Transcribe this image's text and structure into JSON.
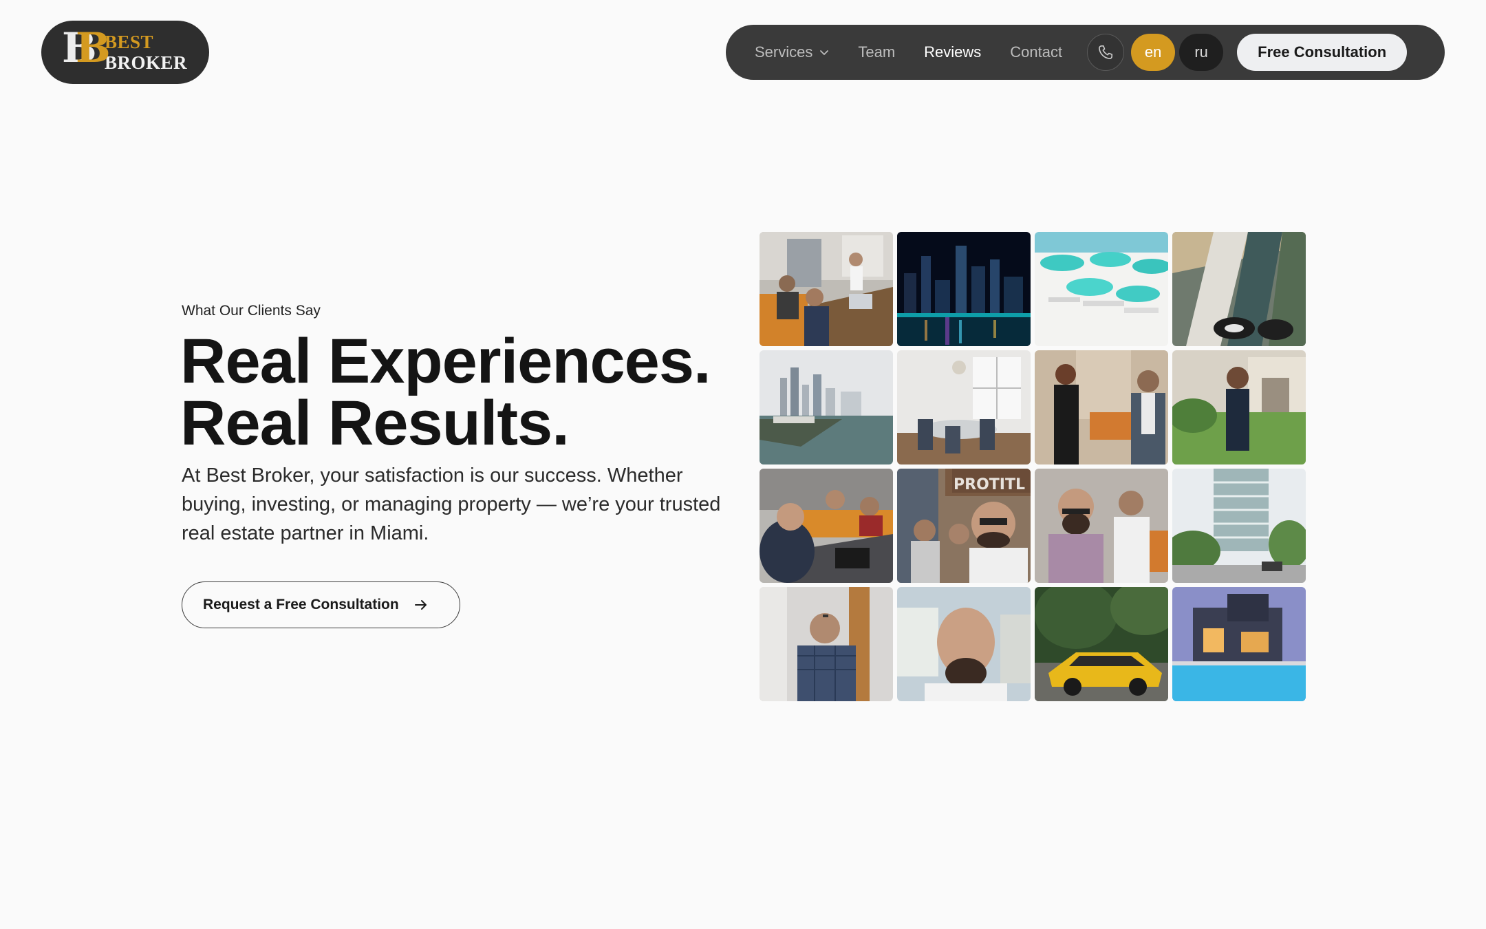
{
  "logo": {
    "monogram": "B",
    "word1": "BEST",
    "word2": "BROKER"
  },
  "nav": {
    "items": [
      {
        "label": "Services",
        "has_dropdown": true,
        "active": false
      },
      {
        "label": "Team",
        "active": false
      },
      {
        "label": "Reviews",
        "active": true
      },
      {
        "label": "Contact",
        "active": false
      }
    ],
    "phone_icon": "phone-icon",
    "languages": [
      {
        "code": "en",
        "selected": true
      },
      {
        "code": "ru",
        "selected": false
      }
    ],
    "cta_label": "Free Consultation"
  },
  "hero": {
    "eyebrow": "What Our Clients Say",
    "headline_line1": "Real Experiences.",
    "headline_line2": "Real Results.",
    "lead": "At Best Broker, your satisfaction is our success. Whether buying, investing, or managing property — we’re your trusted real estate partner in Miami.",
    "cta_label": "Request a Free Consultation",
    "cta_icon": "arrow-right-icon"
  },
  "gallery": {
    "tiles": [
      {
        "subject": "team-meeting-photo"
      },
      {
        "subject": "city-night-skyline-photo"
      },
      {
        "subject": "beach-umbrellas-photo"
      },
      {
        "subject": "aerial-coast-photo"
      },
      {
        "subject": "bay-skyline-photo"
      },
      {
        "subject": "dining-room-interior-photo"
      },
      {
        "subject": "office-conversation-photo"
      },
      {
        "subject": "woman-house-photo"
      },
      {
        "subject": "laptop-meeting-photo"
      },
      {
        "subject": "group-selfie-photo",
        "sign_text": "PROTITL"
      },
      {
        "subject": "two-men-office-photo"
      },
      {
        "subject": "residential-tower-photo"
      },
      {
        "subject": "man-office-portrait-photo"
      },
      {
        "subject": "man-selfie-photo"
      },
      {
        "subject": "yellow-sports-car-photo"
      },
      {
        "subject": "modern-house-pool-photo"
      }
    ]
  },
  "colors": {
    "accent_gold": "#d49a20",
    "nav_bg": "#3a3a3a",
    "page_bg": "#fafafa"
  }
}
